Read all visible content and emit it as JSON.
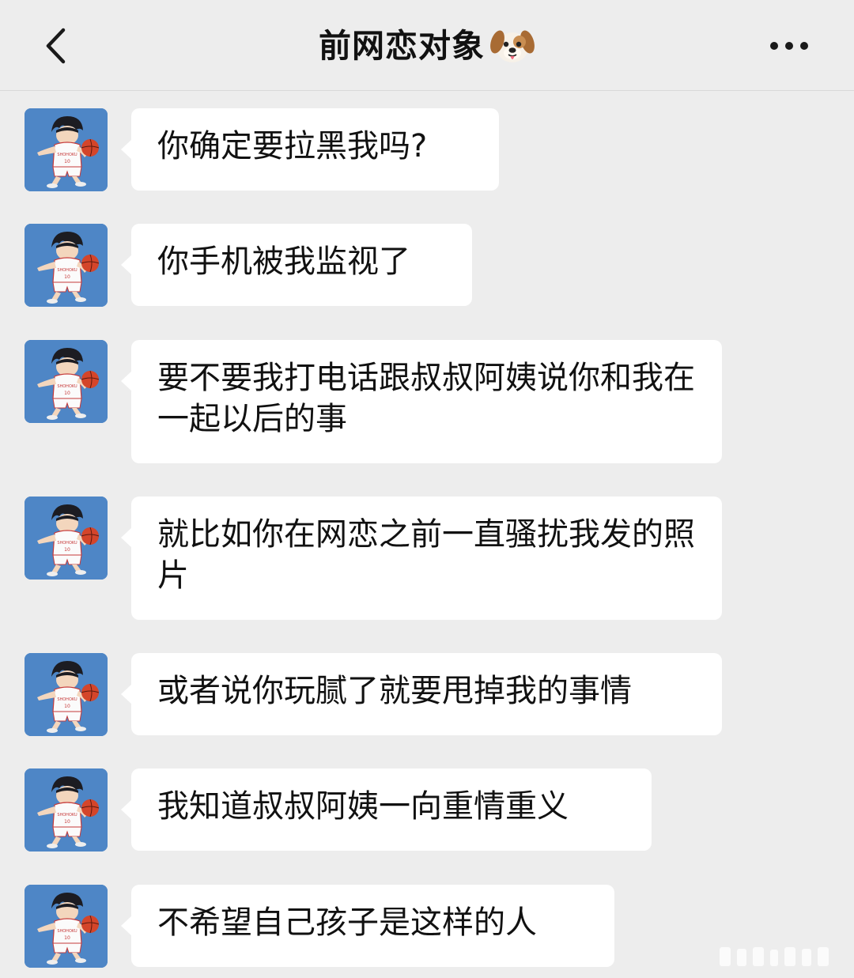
{
  "header": {
    "title": "前网恋对象",
    "title_icon": "dog-face-icon",
    "back_icon": "chevron-left-icon",
    "more_icon": "more-dots-icon"
  },
  "messages": [
    {
      "sender": "other",
      "text": "你确定要拉黑我吗?"
    },
    {
      "sender": "other",
      "text": "你手机被我监视了"
    },
    {
      "sender": "other",
      "text": "要不要我打电话跟叔叔阿姨说你和我在一起以后的事"
    },
    {
      "sender": "other",
      "text": "就比如你在网恋之前一直骚扰我发的照片"
    },
    {
      "sender": "other",
      "text": "或者说你玩腻了就要甩掉我的事情"
    },
    {
      "sender": "other",
      "text": "我知道叔叔阿姨一向重情重义"
    },
    {
      "sender": "other",
      "text": "不希望自己孩子是这样的人"
    }
  ],
  "colors": {
    "background": "#ededed",
    "bubble": "#ffffff",
    "avatar_bg": "#4e86c6",
    "text": "#111111"
  }
}
